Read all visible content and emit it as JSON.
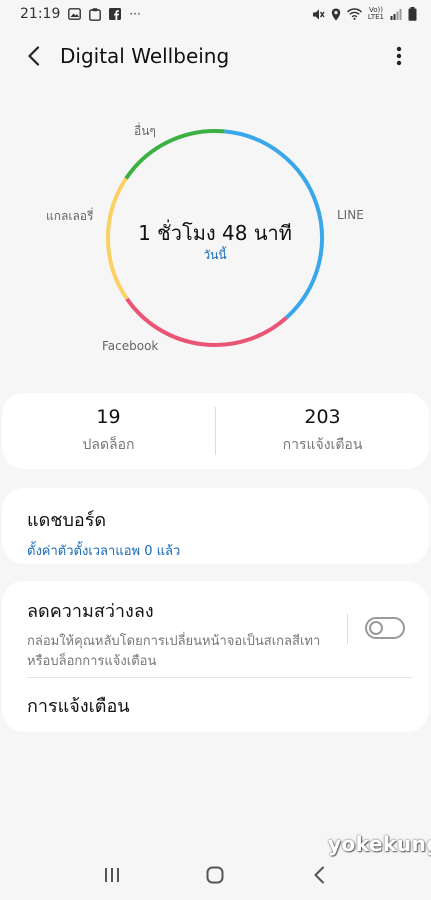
{
  "status_bar": {
    "time": "21:19",
    "more_notifications": "···",
    "left_icons": [
      "gallery-icon",
      "phone-icon",
      "facebook-icon"
    ],
    "right_icons": [
      "mute-icon",
      "location-icon",
      "wifi-icon",
      "volte-icon",
      "signal-icon",
      "battery-icon"
    ],
    "network_label_top": "Vo))",
    "network_label_bottom": "LTE1"
  },
  "app_bar": {
    "title": "Digital Wellbeing",
    "back_icon": "arrow-back-icon",
    "menu_icon": "more-vert-icon"
  },
  "usage_chart": {
    "total_time": "1 ชั่วโมง 48 นาที",
    "period": "วันนี้",
    "segments": [
      {
        "label": "LINE",
        "color": "#3aa7ea",
        "fraction": 0.37
      },
      {
        "label": "Facebook",
        "color": "#ea5576",
        "fraction": 0.27
      },
      {
        "label": "แกลเลอรี่",
        "color": "#fbd166",
        "fraction": 0.19
      },
      {
        "label": "อื่นๆ",
        "color": "#3cb043",
        "fraction": 0.17
      }
    ]
  },
  "stats": {
    "unlocks_value": "19",
    "unlocks_label": "ปลดล็อก",
    "notifications_value": "203",
    "notifications_label": "การแจ้งเตือน"
  },
  "dashboard": {
    "title": "แดชบอร์ด",
    "subtitle": "ตั้งค่าตัวตั้งเวลาแอพ 0 แล้ว"
  },
  "wind_down": {
    "title": "ลดความสว่างลง",
    "description": "กล่อมให้คุณหลับโดยการเปลี่ยนหน้าจอเป็นสเกลสีเทาหรือบล็อกการแจ้งเตือน",
    "enabled": false
  },
  "notifications_row": {
    "title": "การแจ้งเตือน"
  },
  "watermark": "yokekung",
  "nav_bar": {
    "icons": [
      "recent-apps-icon",
      "home-icon",
      "back-icon"
    ]
  }
}
